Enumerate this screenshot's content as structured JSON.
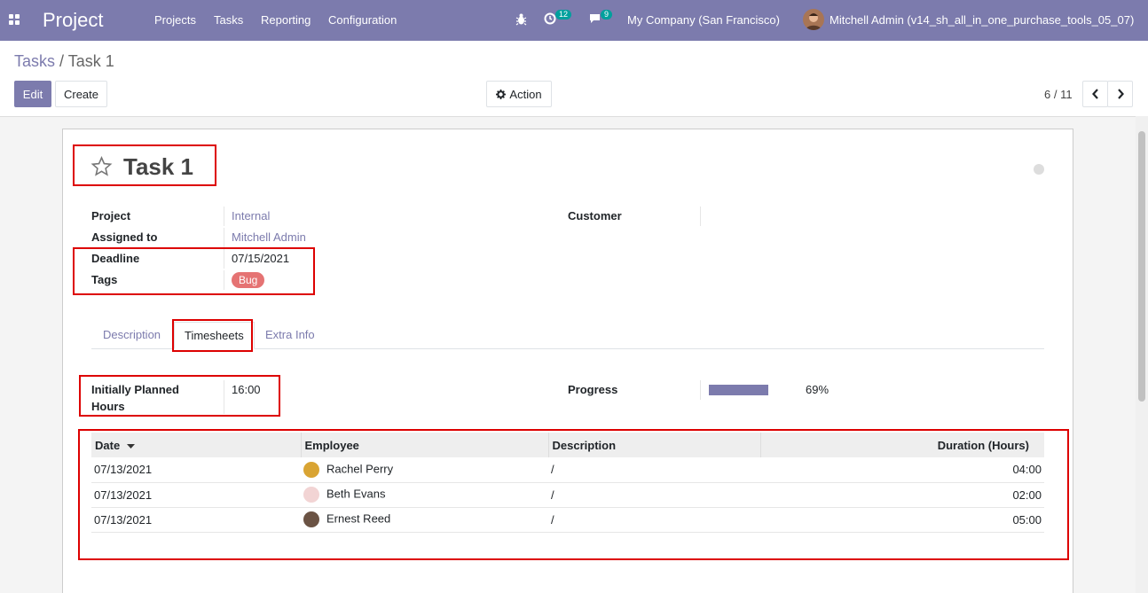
{
  "navbar": {
    "app_name": "Project",
    "menus": [
      "Projects",
      "Tasks",
      "Reporting",
      "Configuration"
    ],
    "activity_count": "12",
    "message_count": "9",
    "company": "My Company (San Francisco)",
    "user": "Mitchell Admin (v14_sh_all_in_one_purchase_tools_05_07)"
  },
  "breadcrumb": {
    "parent": "Tasks",
    "separator": "/",
    "current": "Task 1"
  },
  "buttons": {
    "edit": "Edit",
    "create": "Create",
    "action": "Action"
  },
  "pager": {
    "value": "6 / 11"
  },
  "task": {
    "title": "Task 1",
    "fields": {
      "project_label": "Project",
      "project": "Internal",
      "assigned_label": "Assigned to",
      "assigned": "Mitchell Admin",
      "deadline_label": "Deadline",
      "deadline": "07/15/2021",
      "tags_label": "Tags",
      "tag": "Bug",
      "customer_label": "Customer"
    },
    "tabs": [
      "Description",
      "Timesheets",
      "Extra Info"
    ],
    "planned_label_1": "Initially Planned",
    "planned_label_2": "Hours",
    "planned": "16:00",
    "progress_label": "Progress",
    "progress": "69%",
    "progress_value": 0.69
  },
  "timesheets": {
    "columns": [
      "Date",
      "Employee",
      "Description",
      "Duration (Hours)"
    ],
    "rows": [
      {
        "date": "07/13/2021",
        "employee": "Rachel Perry",
        "description": "/",
        "duration": "04:00"
      },
      {
        "date": "07/13/2021",
        "employee": "Beth Evans",
        "description": "/",
        "duration": "02:00"
      },
      {
        "date": "07/13/2021",
        "employee": "Ernest Reed",
        "description": "/",
        "duration": "05:00"
      }
    ]
  },
  "colors": {
    "brand": "#7c7bad",
    "tag": "#e57373",
    "highlight": "#dd0000",
    "badge": "#00a09d"
  },
  "icons": {
    "apps": "grid-icon",
    "bug": "bug-icon",
    "activity": "clock-icon",
    "messages": "chat-icon",
    "star": "star-outline-icon",
    "action": "gear-icon",
    "sort": "caret-down-icon",
    "status": "circle-icon"
  }
}
